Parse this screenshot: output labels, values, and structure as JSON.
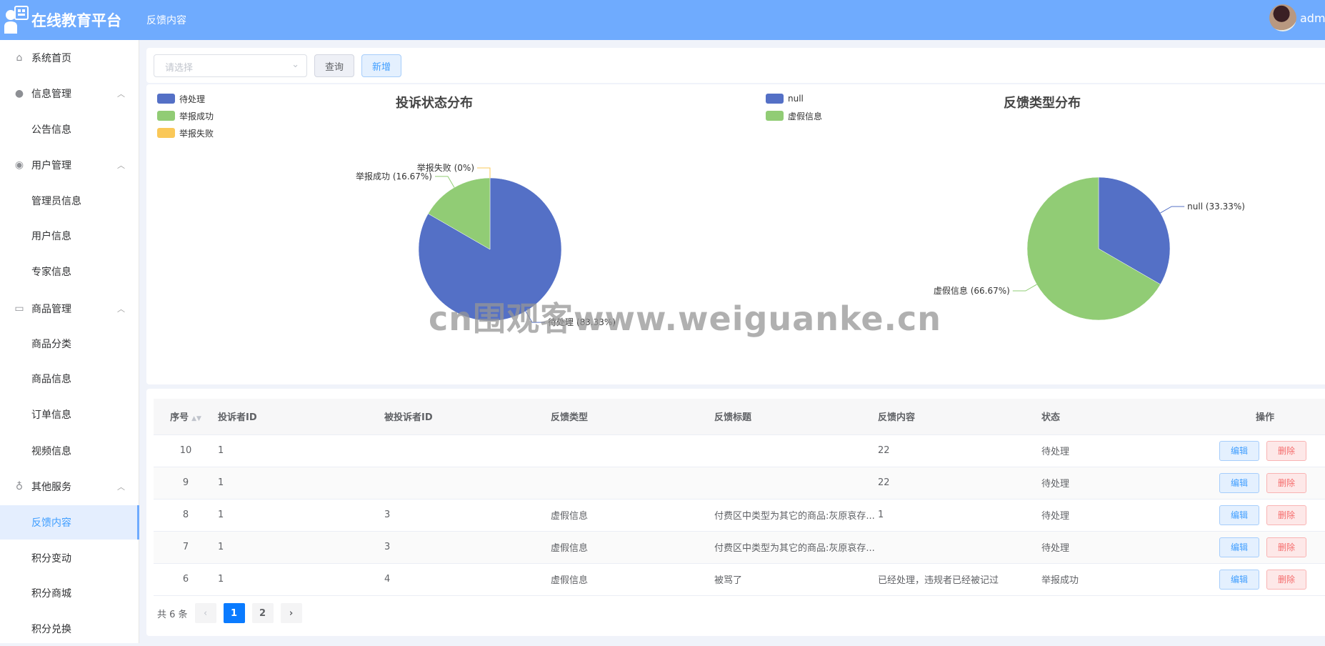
{
  "header": {
    "app_title": "在线教育平台",
    "breadcrumb": "反馈内容",
    "username": "admi"
  },
  "sidebar": {
    "items": [
      {
        "label": "系统首页",
        "icon": "home-icon",
        "type": "item"
      },
      {
        "label": "信息管理",
        "icon": "bulb-icon",
        "type": "group"
      },
      {
        "label": "公告信息",
        "type": "sub"
      },
      {
        "label": "用户管理",
        "icon": "eye-icon",
        "type": "group"
      },
      {
        "label": "管理员信息",
        "type": "sub"
      },
      {
        "label": "用户信息",
        "type": "sub"
      },
      {
        "label": "专家信息",
        "type": "sub"
      },
      {
        "label": "商品管理",
        "icon": "box-icon",
        "type": "group"
      },
      {
        "label": "商品分类",
        "type": "sub"
      },
      {
        "label": "商品信息",
        "type": "sub"
      },
      {
        "label": "订单信息",
        "type": "sub"
      },
      {
        "label": "视频信息",
        "type": "sub"
      },
      {
        "label": "其他服务",
        "icon": "medal-icon",
        "type": "group"
      },
      {
        "label": "反馈内容",
        "type": "sub",
        "active": true
      },
      {
        "label": "积分变动",
        "type": "sub"
      },
      {
        "label": "积分商城",
        "type": "sub"
      },
      {
        "label": "积分兑换",
        "type": "sub"
      }
    ]
  },
  "toolbar": {
    "select_placeholder": "请选择",
    "query_label": "查询",
    "add_label": "新增"
  },
  "chart_data": [
    {
      "type": "pie",
      "title": "投诉状态分布",
      "categories": [
        "待处理",
        "举报成功",
        "举报失败"
      ],
      "values": [
        83.33,
        16.67,
        0
      ],
      "labels": [
        "待处理 (83.33%)",
        "举报成功 (16.67%)",
        "举报失败 (0%)"
      ],
      "colors": [
        "#5470c6",
        "#91cc75",
        "#fac858"
      ],
      "legend": "top-left"
    },
    {
      "type": "pie",
      "title": "反馈类型分布",
      "categories": [
        "null",
        "虚假信息"
      ],
      "values": [
        33.33,
        66.67
      ],
      "labels": [
        "null (33.33%)",
        "虚假信息 (66.67%)"
      ],
      "colors": [
        "#5470c6",
        "#91cc75"
      ],
      "legend": "top-left"
    }
  ],
  "watermark": "cn围观客www.weiguanke.cn",
  "table": {
    "headers": [
      "序号",
      "投诉者ID",
      "被投诉者ID",
      "反馈类型",
      "反馈标题",
      "反馈内容",
      "状态",
      "操作"
    ],
    "rows": [
      [
        "10",
        "1",
        "",
        "",
        "",
        "22",
        "待处理"
      ],
      [
        "9",
        "1",
        "",
        "",
        "",
        "22",
        "待处理"
      ],
      [
        "8",
        "1",
        "3",
        "虚假信息",
        "付费区中类型为其它的商品:灰原哀存...",
        "1",
        "待处理"
      ],
      [
        "7",
        "1",
        "3",
        "虚假信息",
        "付费区中类型为其它的商品:灰原哀存...",
        "",
        "待处理"
      ],
      [
        "6",
        "1",
        "4",
        "虚假信息",
        "被骂了",
        "已经处理，违规者已经被记过",
        "举报成功"
      ]
    ],
    "edit_label": "编辑",
    "delete_label": "删除"
  },
  "pagination": {
    "total_text": "共 6 条",
    "pages": [
      "1",
      "2"
    ],
    "current": "1"
  }
}
